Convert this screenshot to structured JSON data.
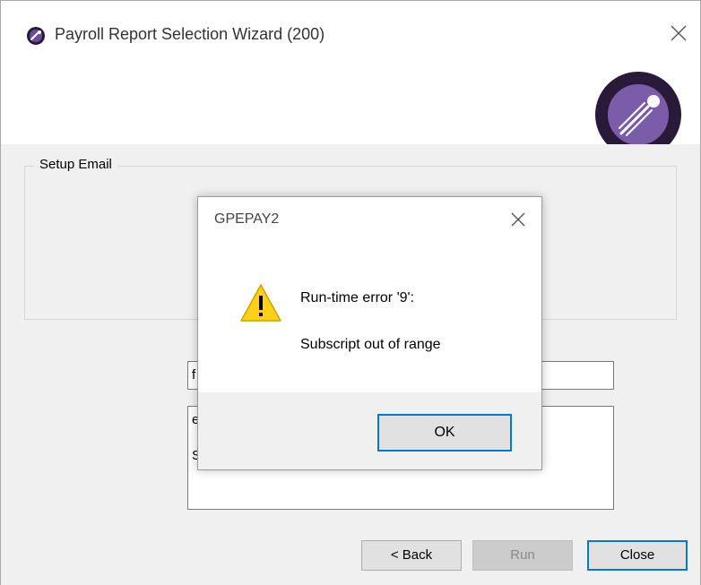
{
  "window": {
    "title": "Payroll Report Selection Wizard (200)",
    "icon": "app-orb-icon",
    "close_icon": "close-icon"
  },
  "header": {
    "logo": "rocket-orb-logo",
    "logo_color": "#2a1a3a",
    "logo_inner_color": "#7a5ca8"
  },
  "setup_email": {
    "legend": "Setup Email"
  },
  "fields": {
    "subject_visible": "f",
    "body_line1": "e",
    "body_line2": "S"
  },
  "buttons": {
    "back_label": "< Back",
    "run_label": "Run",
    "close_label": "Close"
  },
  "dialog": {
    "title": "GPEPAY2",
    "message_line1": "Run-time error '9':",
    "message_line2": "Subscript out of range",
    "ok_label": "OK",
    "icon": "warning-icon",
    "icon_color": "#fcd116",
    "accent_color": "#0078d7"
  }
}
